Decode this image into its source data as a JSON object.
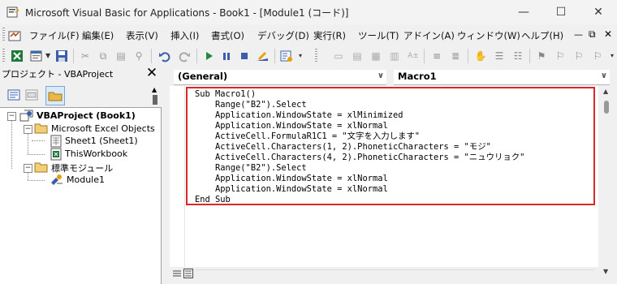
{
  "window": {
    "title": "Microsoft Visual Basic for Applications - Book1 - [Module1 (コード)]",
    "minimize_symbol": "—",
    "maximize_symbol": "☐",
    "close_symbol": "✕"
  },
  "menu": {
    "items": [
      "ファイル(F)",
      "編集(E)",
      "表示(V)",
      "挿入(I)",
      "書式(O)",
      "デバッグ(D)",
      "実行(R)",
      "ツール(T)",
      "アドイン(A)",
      "ウィンドウ(W)",
      "ヘルプ(H)"
    ],
    "mdi_min": "—",
    "mdi_restore": "⧉",
    "mdi_close": "✕"
  },
  "project_pane": {
    "title": "プロジェクト - VBAProject",
    "close": "✕",
    "tree": {
      "root": "VBAProject (Book1)",
      "folder1": "Microsoft Excel Objects",
      "sheet1": "Sheet1 (Sheet1)",
      "workbook": "ThisWorkbook",
      "folder2": "標準モジュール",
      "module1": "Module1"
    }
  },
  "code_pane": {
    "object_combo": "(General)",
    "proc_combo": "Macro1",
    "lines": [
      "Sub Macro1()",
      "    Range(\"B2\").Select",
      "    Application.WindowState = xlMinimized",
      "    Application.WindowState = xlNormal",
      "    ActiveCell.FormulaR1C1 = \"文字を入力します\"",
      "    ActiveCell.Characters(1, 2).PhoneticCharacters = \"モジ\"",
      "    ActiveCell.Characters(4, 2).PhoneticCharacters = \"ニュウリョク\"",
      "    Range(\"B2\").Select",
      "    Application.WindowState = xlNormal",
      "    Application.WindowState = xlNormal",
      "End Sub"
    ]
  },
  "colors": {
    "highlight_border": "#d42a2a",
    "background": "#f0f0f0"
  }
}
